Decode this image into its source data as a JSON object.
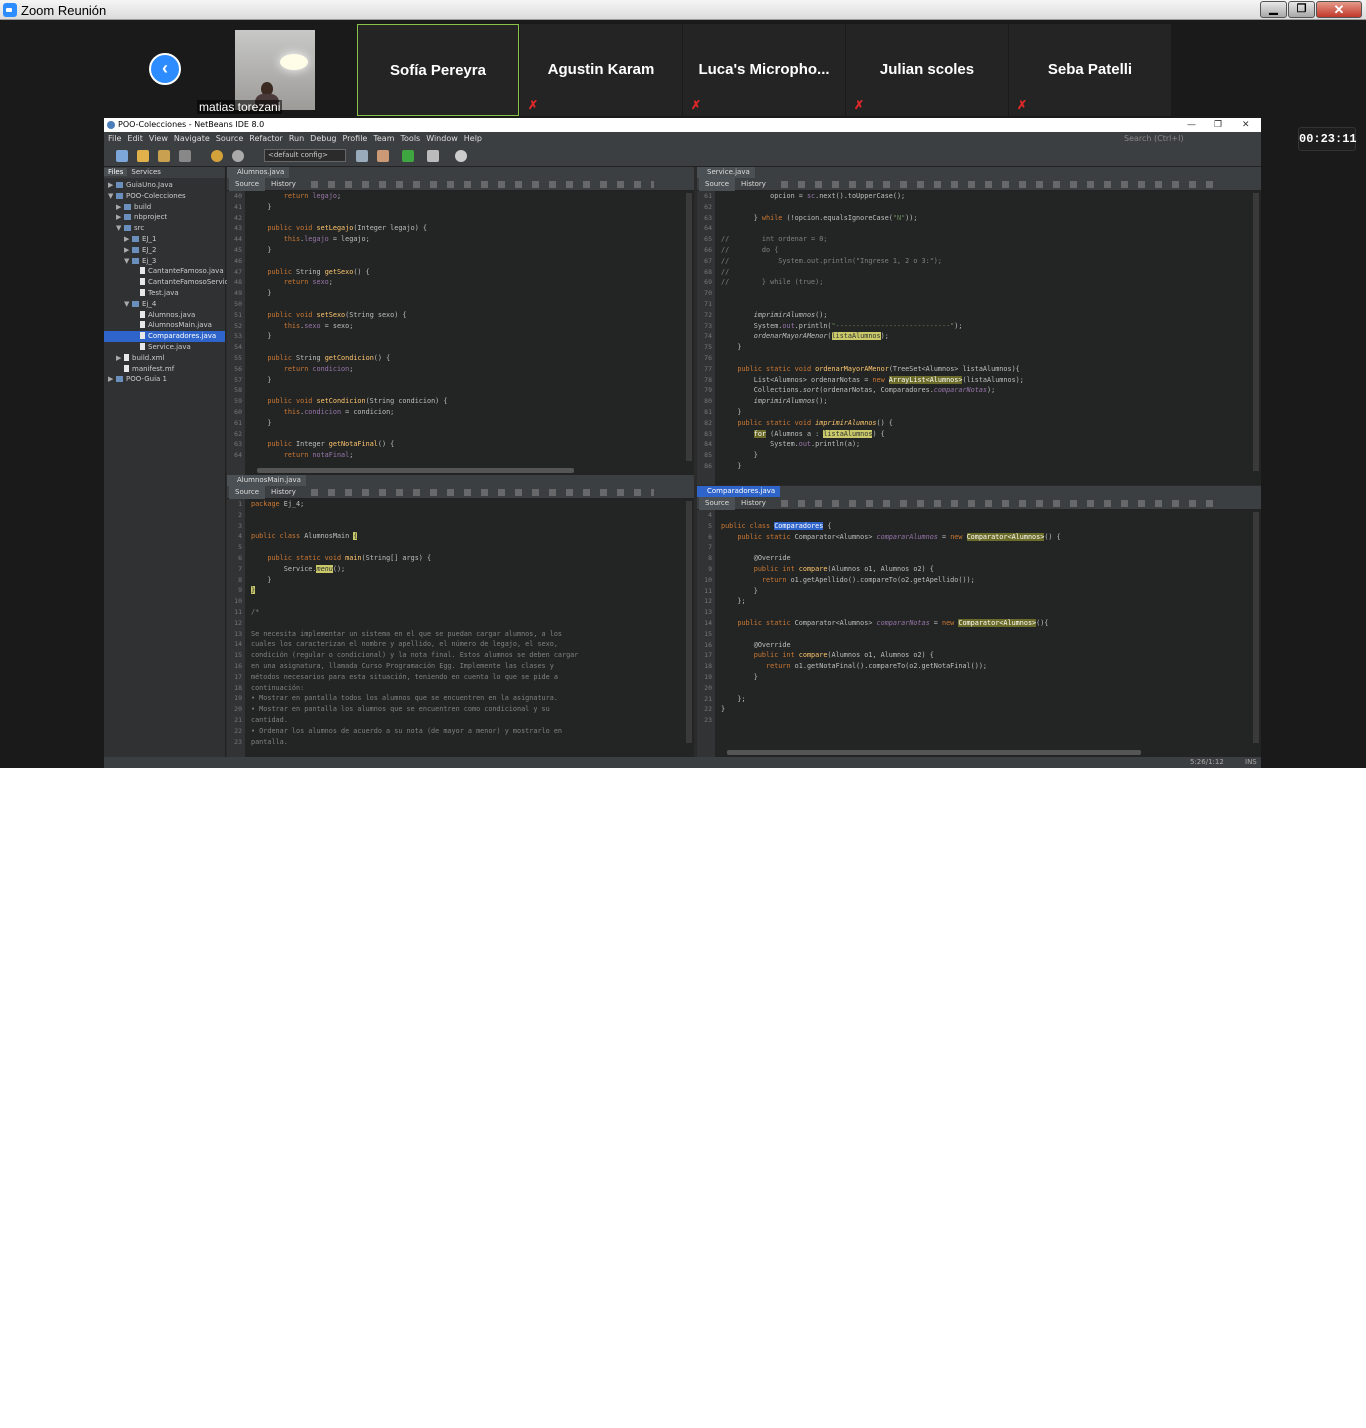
{
  "zoom": {
    "window_title": "Zoom Reunión",
    "window_buttons": {
      "minimize": "▁",
      "maximize": "❐",
      "close": "✕"
    },
    "prev_page_icon": "chevron-left-icon",
    "participants": [
      {
        "name": "matias torezani",
        "video": true,
        "muted": false
      },
      {
        "name": "Sofía Pereyra",
        "video": false,
        "muted": false,
        "active_speaker": true
      },
      {
        "name": "Agustin Karam",
        "video": false,
        "muted": true
      },
      {
        "name": "Luca's  Micropho...",
        "video": false,
        "muted": true
      },
      {
        "name": "Julian scoles",
        "video": false,
        "muted": true
      },
      {
        "name": "Seba Patelli",
        "video": false,
        "muted": true
      }
    ],
    "timer": "00:23:11",
    "active_speaker_border_color": "#8bc34a",
    "mute_icon_color": "#e02828"
  },
  "ide": {
    "title": "POO-Colecciones - NetBeans IDE 8.0",
    "menu": [
      "File",
      "Edit",
      "View",
      "Navigate",
      "Source",
      "Refactor",
      "Run",
      "Debug",
      "Profile",
      "Team",
      "Tools",
      "Window",
      "Help"
    ],
    "search_placeholder": "Search (Ctrl+I)",
    "config": "<default config>",
    "panel_tabs": [
      "Files",
      "Services"
    ],
    "tree": [
      {
        "label": "GuiaUno.Java",
        "depth": 0,
        "arrow": "▶",
        "type": "project"
      },
      {
        "label": "POO-Colecciones",
        "depth": 0,
        "arrow": "▼",
        "type": "project"
      },
      {
        "label": "build",
        "depth": 1,
        "arrow": "▶",
        "type": "folder"
      },
      {
        "label": "nbproject",
        "depth": 1,
        "arrow": "▶",
        "type": "folder"
      },
      {
        "label": "src",
        "depth": 1,
        "arrow": "▼",
        "type": "folder"
      },
      {
        "label": "EJ_1",
        "depth": 2,
        "arrow": "▶",
        "type": "folder"
      },
      {
        "label": "EJ_2",
        "depth": 2,
        "arrow": "▶",
        "type": "folder"
      },
      {
        "label": "Ej_3",
        "depth": 2,
        "arrow": "▼",
        "type": "folder"
      },
      {
        "label": "CantanteFamoso.java",
        "depth": 3,
        "arrow": "",
        "type": "file"
      },
      {
        "label": "CantanteFamosoServic",
        "depth": 3,
        "arrow": "",
        "type": "file"
      },
      {
        "label": "Test.java",
        "depth": 3,
        "arrow": "",
        "type": "file"
      },
      {
        "label": "Ej_4",
        "depth": 2,
        "arrow": "▼",
        "type": "folder"
      },
      {
        "label": "Alumnos.java",
        "depth": 3,
        "arrow": "",
        "type": "file"
      },
      {
        "label": "AlumnosMain.java",
        "depth": 3,
        "arrow": "",
        "type": "file"
      },
      {
        "label": "Comparadores.java",
        "depth": 3,
        "arrow": "",
        "type": "file",
        "selected": true
      },
      {
        "label": "Service.java",
        "depth": 3,
        "arrow": "",
        "type": "file"
      },
      {
        "label": "build.xml",
        "depth": 1,
        "arrow": "▶",
        "type": "file"
      },
      {
        "label": "manifest.mf",
        "depth": 1,
        "arrow": "",
        "type": "file"
      },
      {
        "label": "POO-Guia 1",
        "depth": 0,
        "arrow": "▶",
        "type": "project"
      }
    ],
    "editor_tool_labels": {
      "source": "Source",
      "history": "History"
    },
    "editors": {
      "alumnos": {
        "tab": "Alumnos.java",
        "lines": [
          {
            "n": "40",
            "h": "        <span class=\"kw\">return</span> <span class=\"fld\">legajo</span>;"
          },
          {
            "n": "41",
            "h": "    }"
          },
          {
            "n": "42",
            "h": ""
          },
          {
            "n": "43",
            "h": "    <span class=\"kw\">public void</span> <span class=\"fn\">setLegajo</span>(Integer legajo) {"
          },
          {
            "n": "44",
            "h": "        <span class=\"kw\">this</span>.<span class=\"fld\">legajo</span> = legajo;"
          },
          {
            "n": "45",
            "h": "    }"
          },
          {
            "n": "46",
            "h": ""
          },
          {
            "n": "47",
            "h": "    <span class=\"kw\">public</span> String <span class=\"fn\">getSexo</span>() {"
          },
          {
            "n": "48",
            "h": "        <span class=\"kw\">return</span> <span class=\"fld\">sexo</span>;"
          },
          {
            "n": "49",
            "h": "    }"
          },
          {
            "n": "50",
            "h": ""
          },
          {
            "n": "51",
            "h": "    <span class=\"kw\">public void</span> <span class=\"fn\">setSexo</span>(String sexo) {"
          },
          {
            "n": "52",
            "h": "        <span class=\"kw\">this</span>.<span class=\"fld\">sexo</span> = sexo;"
          },
          {
            "n": "53",
            "h": "    }"
          },
          {
            "n": "54",
            "h": ""
          },
          {
            "n": "55",
            "h": "    <span class=\"kw\">public</span> String <span class=\"fn\">getCondicion</span>() {"
          },
          {
            "n": "56",
            "h": "        <span class=\"kw\">return</span> <span class=\"fld\">condicion</span>;"
          },
          {
            "n": "57",
            "h": "    }"
          },
          {
            "n": "58",
            "h": ""
          },
          {
            "n": "59",
            "h": "    <span class=\"kw\">public void</span> <span class=\"fn\">setCondicion</span>(String condicion) {"
          },
          {
            "n": "60",
            "h": "        <span class=\"kw\">this</span>.<span class=\"fld\">condicion</span> = condicion;"
          },
          {
            "n": "61",
            "h": "    }"
          },
          {
            "n": "62",
            "h": ""
          },
          {
            "n": "63",
            "h": "    <span class=\"kw\">public</span> Integer <span class=\"fn\">getNotaFinal</span>() {"
          },
          {
            "n": "64",
            "h": "        <span class=\"kw\">return</span> <span class=\"fld\">notaFinal</span>;"
          }
        ]
      },
      "service": {
        "tab": "Service.java",
        "lines": [
          {
            "n": "61",
            "h": "            opcion = <span class=\"fld\">sc</span>.next().toUpperCase();"
          },
          {
            "n": "62",
            "h": ""
          },
          {
            "n": "63",
            "h": "        } <span class=\"kw\">while</span> (!opcion.equalsIgnoreCase(<span class=\"str\">\"N\"</span>));"
          },
          {
            "n": "64",
            "h": ""
          },
          {
            "n": "65",
            "h": "<span class=\"cm\">//        int ordenar = 0;</span>"
          },
          {
            "n": "66",
            "h": "<span class=\"cm\">//        do {</span>"
          },
          {
            "n": "67",
            "h": "<span class=\"cm\">//            System.out.println(\"Ingrese 1, 2 o 3:\");</span>"
          },
          {
            "n": "68",
            "h": "<span class=\"cm\">//</span>"
          },
          {
            "n": "69",
            "h": "<span class=\"cm\">//        } while (true);</span>"
          },
          {
            "n": "70",
            "h": ""
          },
          {
            "n": "71",
            "h": ""
          },
          {
            "n": "72",
            "h": "        <i>imprimirAlumnos</i>();"
          },
          {
            "n": "73",
            "h": "        System.<span class=\"fld\">out</span>.println(<span class=\"str\">\"----------------------------\"</span>);"
          },
          {
            "n": "74",
            "h": "        <i>ordenarMayorAMenor</i>(<span class=\"hy\">listaAlumnos</span>);"
          },
          {
            "n": "75",
            "h": "    }"
          },
          {
            "n": "76",
            "h": ""
          },
          {
            "n": "77",
            "h": "    <span class=\"kw\">public static void</span> <span class=\"fn\">ordenarMayorAMenor</span>(TreeSet&lt;Alumnos&gt; listaAlumnos){"
          },
          {
            "n": "78",
            "h": "        List&lt;Alumnos&gt; ordenarNotas = <span class=\"kw\">new</span> <span class=\"hl\">ArrayList&lt;Alumnos&gt;</span>(listaAlumnos);"
          },
          {
            "n": "79",
            "h": "        Collections.<i>sort</i>(ordenarNotas, Comparadores.<span class=\"fld\"><i>compararNotas</i></span>);"
          },
          {
            "n": "80",
            "h": "        <i>imprimirAlumnos</i>();"
          },
          {
            "n": "81",
            "h": "    }"
          },
          {
            "n": "82",
            "h": "    <span class=\"kw\">public static void</span> <span class=\"fn\"><i>imprimirAlumnos</i></span>() {"
          },
          {
            "n": "83",
            "h": "        <span class=\"hl\">for</span> (Alumnos a : <span class=\"hy\">listaAlumnos</span>) {"
          },
          {
            "n": "84",
            "h": "            System.<span class=\"fld\">out</span>.println(a);"
          },
          {
            "n": "85",
            "h": "        }"
          },
          {
            "n": "86",
            "h": "    }"
          }
        ]
      },
      "alumnosmain": {
        "tab": "AlumnosMain.java",
        "lines": [
          {
            "n": "1",
            "h": "<span class=\"kw\">package</span> Ej_4;"
          },
          {
            "n": "2",
            "h": ""
          },
          {
            "n": "3",
            "h": ""
          },
          {
            "n": "4",
            "h": "<span class=\"kw\">public class</span> AlumnosMain <span class=\"hy\">{</span>"
          },
          {
            "n": "5",
            "h": ""
          },
          {
            "n": "6",
            "h": "    <span class=\"kw\">public static void</span> <span class=\"fn\">main</span>(String[] args) {"
          },
          {
            "n": "7",
            "h": "        Service.<span class=\"hy\"><i>menu</i></span>();"
          },
          {
            "n": "8",
            "h": "    }"
          },
          {
            "n": "9",
            "h": "<span class=\"hy\">}</span>"
          },
          {
            "n": "10",
            "h": ""
          },
          {
            "n": "11",
            "h": "<span class=\"cm\">/*</span>"
          },
          {
            "n": "12",
            "h": ""
          },
          {
            "n": "13",
            "h": "<span class=\"cm\">Se necesita implementar un sistema en el que se puedan cargar alumnos, a los</span>"
          },
          {
            "n": "14",
            "h": "<span class=\"cm\">cuales los caracterizan el nombre y apellido, el número de legajo, el sexo,</span>"
          },
          {
            "n": "15",
            "h": "<span class=\"cm\">condición (regular o condicional) y la nota final. Estos alumnos se deben cargar</span>"
          },
          {
            "n": "16",
            "h": "<span class=\"cm\">en una asignatura, llamada Curso Programación Egg. Implemente las clases y</span>"
          },
          {
            "n": "17",
            "h": "<span class=\"cm\">métodos necesarios para esta situación, teniendo en cuenta lo que se pide a</span>"
          },
          {
            "n": "18",
            "h": "<span class=\"cm\">continuación:</span>"
          },
          {
            "n": "19",
            "h": "<span class=\"cm\">• Mostrar en pantalla todos los alumnos que se encuentren en la asignatura.</span>"
          },
          {
            "n": "20",
            "h": "<span class=\"cm\">• Mostrar en pantalla los alumnos que se encuentren como condicional y su</span>"
          },
          {
            "n": "21",
            "h": "<span class=\"cm\">cantidad.</span>"
          },
          {
            "n": "22",
            "h": "<span class=\"cm\">• Ordenar los alumnos de acuerdo a su nota (de mayor a menor) y mostrarlo en</span>"
          },
          {
            "n": "23",
            "h": "<span class=\"cm\">pantalla.</span>"
          }
        ]
      },
      "comparadores": {
        "tab": "Comparadores.java",
        "lines": [
          {
            "n": "4",
            "h": ""
          },
          {
            "n": "5",
            "h": "<span class=\"kw\">public class</span> <span class=\"sel2\">Comparadores</span> {"
          },
          {
            "n": "6",
            "h": "    <span class=\"kw\">public static</span> Comparator&lt;Alumnos&gt; <span class=\"fld\"><i>compararAlumnos</i></span> = <span class=\"kw\">new</span> <span class=\"hl\">Comparator&lt;Alumnos&gt;</span>() {"
          },
          {
            "n": "7",
            "h": ""
          },
          {
            "n": "8",
            "h": "        @Override"
          },
          {
            "n": "9",
            "h": "        <span class=\"kw\">public int</span> <span class=\"fn\">compare</span>(Alumnos o1, Alumnos o2) {"
          },
          {
            "n": "10",
            "h": "          <span class=\"kw\">return</span> o1.getApellido().compareTo(o2.getApellido());"
          },
          {
            "n": "11",
            "h": "        }"
          },
          {
            "n": "12",
            "h": "    };"
          },
          {
            "n": "13",
            "h": ""
          },
          {
            "n": "14",
            "h": "    <span class=\"kw\">public static</span> Comparator&lt;Alumnos&gt; <span class=\"fld\"><i>compararNotas</i></span> = <span class=\"kw\">new</span> <span class=\"hl\">Comparator&lt;Alumnos&gt;</span>(){"
          },
          {
            "n": "15",
            "h": ""
          },
          {
            "n": "16",
            "h": "        @Override"
          },
          {
            "n": "17",
            "h": "        <span class=\"kw\">public int</span> <span class=\"fn\">compare</span>(Alumnos o1, Alumnos o2) {"
          },
          {
            "n": "18",
            "h": "           <span class=\"kw\">return</span> o1.getNotaFinal().compareTo(o2.getNotaFinal());"
          },
          {
            "n": "19",
            "h": "        }"
          },
          {
            "n": "20",
            "h": ""
          },
          {
            "n": "21",
            "h": "    };"
          },
          {
            "n": "22",
            "h": "}"
          },
          {
            "n": "23",
            "h": ""
          }
        ]
      }
    },
    "status": {
      "position": "5:26/1:12",
      "mode": "INS"
    }
  }
}
